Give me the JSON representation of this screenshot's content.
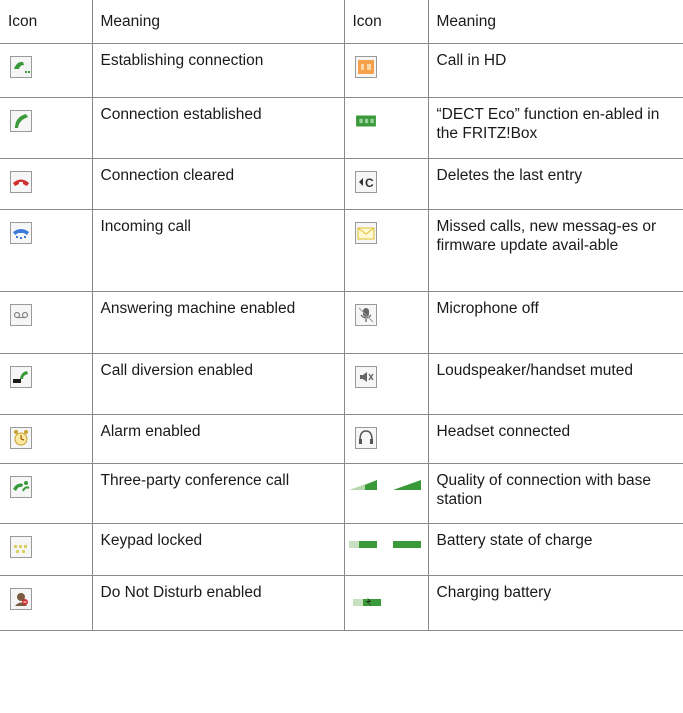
{
  "header": {
    "icon": "Icon",
    "meaning": "Meaning",
    "icon2": "Icon",
    "meaning2": "Meaning"
  },
  "rows": [
    {
      "left": {
        "icon": "establishing-connection-icon",
        "meaning": "Establishing connection"
      },
      "right": {
        "icon": "hd-call-icon",
        "meaning": "Call in HD"
      }
    },
    {
      "left": {
        "icon": "handset-green-icon",
        "meaning": "Connection established"
      },
      "right": {
        "icon": "dect-eco-icon",
        "meaning": "“DECT Eco” function en-abled in the FRITZ!Box"
      }
    },
    {
      "left": {
        "icon": "handset-red-icon",
        "meaning": "Connection cleared"
      },
      "right": {
        "icon": "clear-icon",
        "meaning": "Deletes the last entry"
      }
    },
    {
      "left": {
        "icon": "incoming-call-icon",
        "meaning": "Incoming call"
      },
      "right": {
        "icon": "envelope-icon",
        "meaning": "Missed calls, new messag-es or firmware update avail-able"
      }
    },
    {
      "left": {
        "icon": "answering-machine-icon",
        "meaning": "Answering machine enabled"
      },
      "right": {
        "icon": "microphone-off-icon",
        "meaning": "Microphone off"
      }
    },
    {
      "left": {
        "icon": "call-diversion-icon",
        "meaning": "Call diversion enabled"
      },
      "right": {
        "icon": "speaker-muted-icon",
        "meaning": "Loudspeaker/handset muted"
      }
    },
    {
      "left": {
        "icon": "alarm-icon",
        "meaning": "Alarm enabled"
      },
      "right": {
        "icon": "headset-icon",
        "meaning": "Headset connected"
      }
    },
    {
      "left": {
        "icon": "conference-call-icon",
        "meaning": "Three-party conference call"
      },
      "right": {
        "icon": "signal-quality-icon",
        "meaning": "Quality of connection with base station"
      }
    },
    {
      "left": {
        "icon": "keypad-locked-icon",
        "meaning": "Keypad locked"
      },
      "right": {
        "icon": "battery-icon",
        "meaning": "Battery state of charge"
      }
    },
    {
      "left": {
        "icon": "do-not-disturb-icon",
        "meaning": "Do Not Disturb enabled"
      },
      "right": {
        "icon": "battery-charging-icon",
        "meaning": "Charging battery"
      }
    }
  ],
  "colors": {
    "border": "#8a8a8a",
    "green": "#3a9a3a",
    "red": "#d03030",
    "blue": "#3a7ad8",
    "orange": "#f08a30",
    "yellow": "#f0d040"
  }
}
